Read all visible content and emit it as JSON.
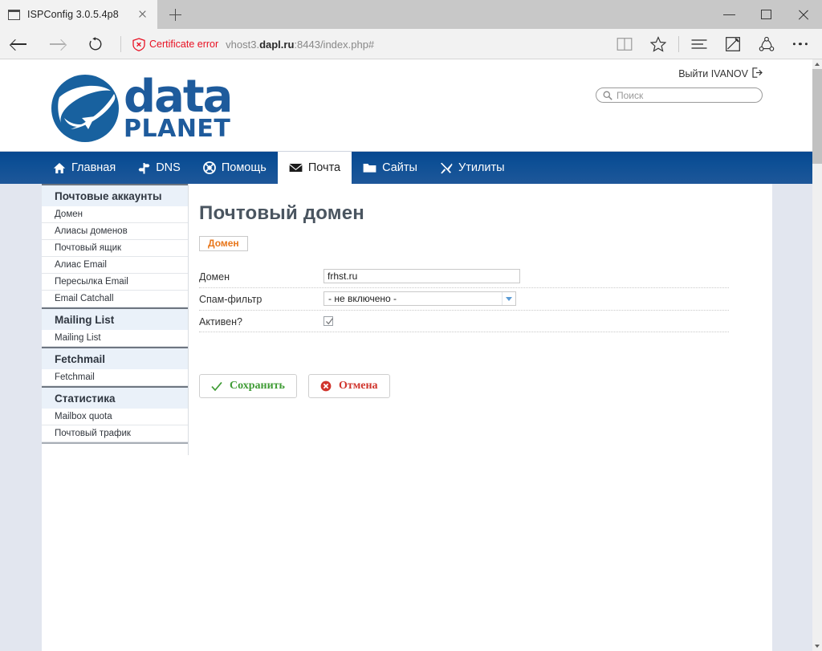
{
  "browser": {
    "tab": {
      "title": "ISPConfig 3.0.5.4p8",
      "icon": "window-icon",
      "close": "×"
    },
    "newtab_label": "+",
    "window_controls": {
      "minimize": "—",
      "maximize": "□",
      "close": "×"
    },
    "nav": {
      "back": "back-arrow",
      "forward": "forward-arrow",
      "refresh": "refresh-icon"
    },
    "address": {
      "cert_status": "Certificate error",
      "url_prefix": "vhost3.",
      "url_domain": "dapl.ru",
      "url_suffix": ":8443/index.php#"
    },
    "toolbar_icons": [
      "reading-view-icon",
      "favorites-star-icon",
      "hub-icon",
      "web-note-icon",
      "share-icon",
      "more-icon"
    ]
  },
  "header": {
    "logo": {
      "line1": "data",
      "line2": "PLANET",
      "color": "#1e5b9c"
    },
    "logout_label": "Выйти IVANOV",
    "search": {
      "placeholder": "Поиск",
      "value": ""
    }
  },
  "nav": {
    "items": [
      {
        "label": "Главная",
        "icon": "home-icon",
        "active": false
      },
      {
        "label": "DNS",
        "icon": "signpost-icon",
        "active": false
      },
      {
        "label": "Помощь",
        "icon": "lifebuoy-icon",
        "active": false
      },
      {
        "label": "Почта",
        "icon": "envelope-icon",
        "active": true
      },
      {
        "label": "Сайты",
        "icon": "folder-icon",
        "active": false
      },
      {
        "label": "Утилиты",
        "icon": "tools-icon",
        "active": false
      }
    ]
  },
  "sidebar": {
    "groups": [
      {
        "title": "Почтовые аккаунты",
        "items": [
          "Домен",
          "Алиасы доменов",
          "Почтовый ящик",
          "Алиас Email",
          "Пересылка Email",
          "Email Catchall"
        ]
      },
      {
        "title": "Mailing List",
        "items": [
          "Mailing List"
        ]
      },
      {
        "title": "Fetchmail",
        "items": [
          "Fetchmail"
        ]
      },
      {
        "title": "Статистика",
        "items": [
          "Mailbox quota",
          "Почтовый трафик"
        ]
      }
    ]
  },
  "main": {
    "title": "Почтовый домен",
    "tab_label": "Домен",
    "fields": [
      {
        "label": "Домен",
        "type": "text",
        "value": "frhst.ru"
      },
      {
        "label": "Спам-фильтр",
        "type": "select",
        "value": "- не включено -"
      },
      {
        "label": "Активен?",
        "type": "checkbox",
        "checked": true
      }
    ],
    "buttons": {
      "save": {
        "label": "Сохранить",
        "icon": "check-icon",
        "color": "#3f9c35"
      },
      "cancel": {
        "label": "Отмена",
        "icon": "cancel-circle-icon",
        "color": "#d0342c"
      }
    }
  }
}
